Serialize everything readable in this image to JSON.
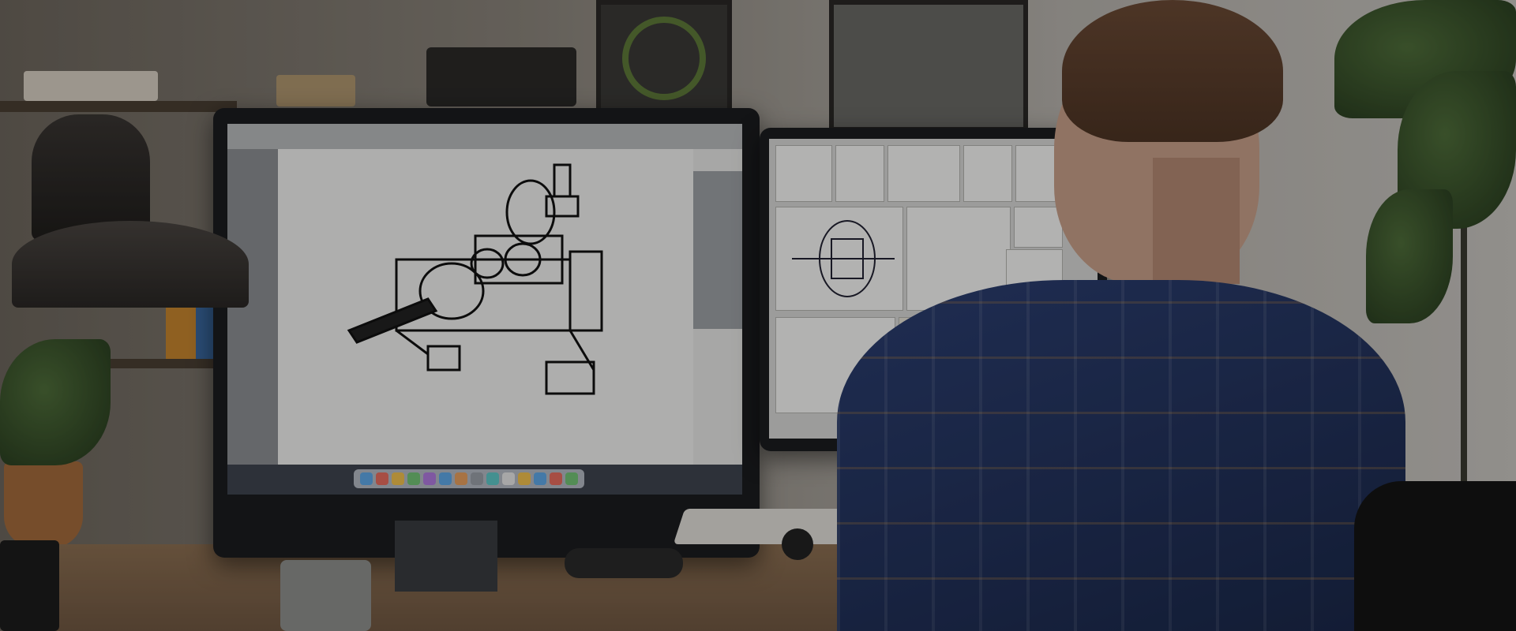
{
  "scene": {
    "description_tag": "photo",
    "colors": {
      "shirt": "#2c3f72",
      "desk": "#8c6f52",
      "wall": "#8b857c",
      "monitor_bezel": "#1b1c1f"
    }
  },
  "icons": {
    "desk_lamp": "desk-lamp-icon",
    "plant": "plant-icon"
  }
}
